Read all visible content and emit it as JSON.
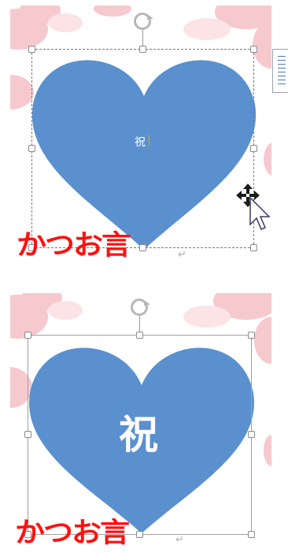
{
  "top_panel": {
    "heart_text": "祝",
    "logo_text": "かつお言",
    "paragraph_mark": "↵",
    "colors": {
      "heart": "#5b90cf",
      "logo": "#ff1010"
    },
    "icons": [
      "rotate-handle-icon",
      "move-cursor-icon",
      "arrow-cursor-icon",
      "side-layout-options-icon"
    ]
  },
  "bottom_panel": {
    "heart_text": "祝",
    "logo_text": "かつお言",
    "paragraph_mark": "↵",
    "colors": {
      "heart": "#5b90cf",
      "logo": "#ff1010"
    },
    "icons": [
      "rotate-handle-icon"
    ]
  }
}
